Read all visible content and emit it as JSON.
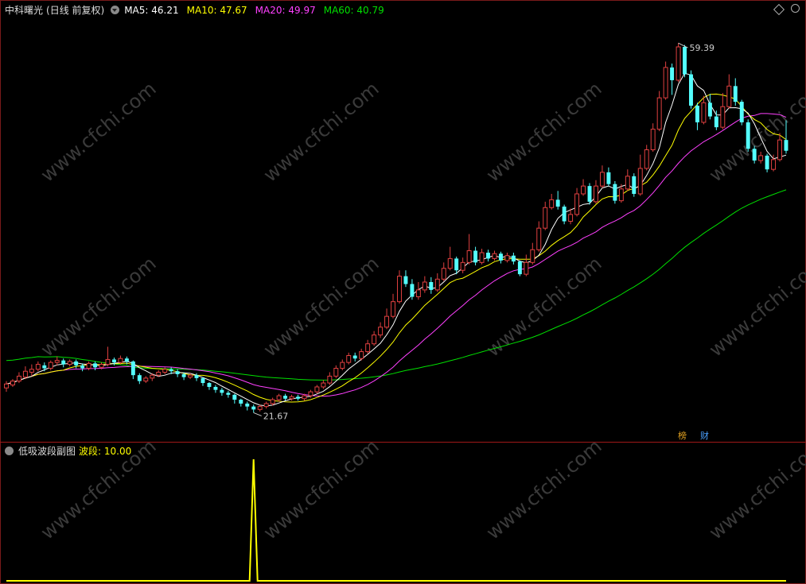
{
  "main_header": {
    "stock_name": "中科曙光",
    "period": "(日线 前复权)",
    "ma_items": [
      {
        "label": "MA5: 46.21",
        "color": "#ffffff"
      },
      {
        "label": "MA10: 47.67",
        "color": "#ffff00"
      },
      {
        "label": "MA20: 49.97",
        "color": "#ff40ff"
      },
      {
        "label": "MA60: 40.79",
        "color": "#00e000"
      }
    ]
  },
  "sub_header": {
    "indicator_name": "低吸波段副图",
    "value_label": "波段: 10.00",
    "value_color": "#ffff00"
  },
  "badges": {
    "left": "榜",
    "right": "财"
  },
  "watermark": "www.cfchi.com",
  "colors": {
    "up": "#e04040",
    "down": "#54ffff",
    "ma5": "#ffffff",
    "ma10": "#ffff00",
    "ma20": "#ff40ff",
    "ma60": "#00e000",
    "border": "#a01818"
  },
  "chart_data": [
    {
      "type": "candlestick",
      "title": "中科曙光 (日线 前复权)",
      "high_label": "59.39",
      "low_label": "21.67",
      "ylim": [
        20,
        62
      ],
      "candles": [
        [
          24.2,
          24.6,
          23.8,
          24.9
        ],
        [
          24.5,
          24.9,
          24.3,
          25.1
        ],
        [
          24.9,
          25.4,
          24.7,
          25.8
        ],
        [
          25.3,
          25.9,
          25.1,
          26.4
        ],
        [
          25.8,
          26.1,
          25.4,
          26.6
        ],
        [
          26.1,
          26.6,
          25.9,
          26.9
        ],
        [
          26.5,
          26.2,
          25.9,
          26.8
        ],
        [
          26.2,
          26.8,
          26.0,
          27.0
        ],
        [
          26.8,
          27.0,
          26.5,
          27.4
        ],
        [
          27.0,
          26.6,
          26.3,
          27.2
        ],
        [
          26.6,
          26.9,
          26.4,
          27.1
        ],
        [
          26.9,
          26.5,
          26.2,
          27.1
        ],
        [
          26.5,
          26.2,
          25.9,
          26.7
        ],
        [
          26.2,
          26.7,
          26.0,
          26.9
        ],
        [
          26.7,
          26.3,
          26.0,
          26.9
        ],
        [
          26.3,
          26.6,
          26.1,
          26.8
        ],
        [
          26.6,
          27.1,
          26.4,
          28.4
        ],
        [
          27.1,
          26.8,
          26.5,
          27.3
        ],
        [
          26.8,
          27.2,
          26.6,
          27.5
        ],
        [
          27.2,
          26.9,
          26.6,
          27.4
        ],
        [
          26.9,
          25.5,
          25.1,
          27.0
        ],
        [
          25.5,
          24.9,
          24.6,
          25.7
        ],
        [
          24.9,
          25.2,
          24.7,
          25.4
        ],
        [
          25.2,
          25.5,
          24.9,
          25.7
        ],
        [
          25.5,
          25.8,
          25.3,
          26.0
        ],
        [
          25.8,
          26.1,
          25.6,
          26.3
        ],
        [
          26.1,
          25.9,
          25.6,
          26.3
        ],
        [
          25.9,
          25.6,
          25.3,
          26.1
        ],
        [
          25.6,
          25.3,
          25.0,
          25.8
        ],
        [
          25.3,
          25.5,
          25.1,
          25.7
        ],
        [
          25.5,
          25.2,
          24.9,
          25.7
        ],
        [
          25.2,
          24.7,
          24.4,
          25.3
        ],
        [
          24.7,
          24.3,
          24.0,
          24.8
        ],
        [
          24.3,
          24.0,
          23.7,
          24.5
        ],
        [
          24.0,
          23.7,
          23.4,
          24.2
        ],
        [
          23.7,
          23.5,
          23.2,
          23.9
        ],
        [
          23.5,
          23.0,
          22.6,
          23.6
        ],
        [
          23.0,
          22.6,
          22.3,
          23.1
        ],
        [
          22.6,
          22.3,
          21.9,
          22.8
        ],
        [
          22.3,
          22.0,
          21.67,
          22.5
        ],
        [
          22.0,
          22.3,
          21.8,
          22.5
        ],
        [
          22.3,
          22.6,
          22.1,
          22.8
        ],
        [
          22.6,
          23.0,
          22.4,
          23.2
        ],
        [
          23.0,
          23.4,
          22.8,
          23.6
        ],
        [
          23.4,
          23.1,
          22.9,
          23.6
        ],
        [
          23.1,
          23.3,
          22.9,
          23.5
        ],
        [
          23.3,
          23.1,
          22.9,
          23.5
        ],
        [
          23.1,
          23.4,
          22.9,
          23.6
        ],
        [
          23.4,
          23.8,
          23.2,
          24.0
        ],
        [
          23.8,
          24.3,
          23.6,
          24.5
        ],
        [
          24.3,
          24.7,
          24.1,
          25.0
        ],
        [
          24.7,
          25.4,
          24.5,
          25.8
        ],
        [
          25.4,
          26.2,
          25.2,
          26.5
        ],
        [
          26.2,
          26.8,
          26.0,
          27.1
        ],
        [
          26.8,
          27.5,
          26.6,
          27.8
        ],
        [
          27.5,
          27.2,
          26.9,
          27.8
        ],
        [
          27.2,
          27.9,
          27.0,
          28.2
        ],
        [
          27.9,
          28.7,
          27.7,
          29.1
        ],
        [
          28.7,
          29.6,
          28.5,
          30.0
        ],
        [
          29.6,
          30.4,
          29.3,
          30.9
        ],
        [
          30.4,
          31.5,
          30.2,
          32.3
        ],
        [
          31.5,
          33.0,
          31.3,
          33.8
        ],
        [
          33.0,
          35.6,
          32.8,
          36.2
        ],
        [
          35.6,
          34.8,
          34.5,
          36.2
        ],
        [
          34.8,
          33.5,
          33.2,
          35.3
        ],
        [
          33.5,
          34.2,
          33.2,
          35.0
        ],
        [
          34.2,
          35.0,
          33.9,
          35.6
        ],
        [
          35.0,
          34.2,
          33.8,
          35.5
        ],
        [
          34.2,
          35.3,
          34.0,
          35.9
        ],
        [
          35.3,
          36.4,
          35.1,
          37.0
        ],
        [
          36.4,
          37.4,
          36.2,
          38.6
        ],
        [
          37.4,
          36.2,
          35.8,
          37.6
        ],
        [
          36.2,
          37.0,
          35.9,
          37.5
        ],
        [
          37.0,
          38.2,
          36.8,
          39.9
        ],
        [
          38.2,
          37.0,
          36.7,
          38.6
        ],
        [
          37.0,
          38.0,
          36.8,
          38.4
        ],
        [
          38.0,
          37.4,
          37.1,
          38.3
        ],
        [
          37.4,
          37.9,
          37.2,
          38.2
        ],
        [
          37.9,
          37.2,
          36.9,
          38.1
        ],
        [
          37.2,
          37.7,
          37.0,
          38.0
        ],
        [
          37.7,
          37.1,
          36.8,
          38.0
        ],
        [
          37.1,
          35.8,
          35.6,
          37.2
        ],
        [
          35.8,
          37.0,
          35.6,
          37.8
        ],
        [
          37.0,
          38.3,
          36.8,
          39.0
        ],
        [
          38.3,
          40.5,
          38.1,
          41.2
        ],
        [
          40.5,
          42.6,
          40.3,
          43.2
        ],
        [
          42.6,
          43.4,
          42.4,
          44.0
        ],
        [
          43.4,
          42.7,
          42.4,
          44.3
        ],
        [
          42.7,
          41.2,
          40.9,
          42.9
        ],
        [
          41.2,
          41.9,
          40.9,
          42.5
        ],
        [
          41.9,
          44.0,
          41.7,
          44.6
        ],
        [
          44.0,
          44.8,
          43.8,
          45.5
        ],
        [
          44.8,
          43.2,
          42.9,
          45.1
        ],
        [
          43.2,
          44.8,
          43.0,
          45.4
        ],
        [
          44.8,
          46.2,
          44.6,
          46.9
        ],
        [
          46.2,
          45.0,
          44.8,
          46.7
        ],
        [
          45.0,
          43.3,
          43.0,
          45.3
        ],
        [
          43.3,
          44.5,
          43.1,
          45.0
        ],
        [
          44.5,
          45.8,
          44.3,
          46.5
        ],
        [
          45.8,
          44.0,
          43.7,
          46.1
        ],
        [
          44.0,
          46.6,
          43.8,
          48.0
        ],
        [
          46.6,
          48.5,
          46.4,
          49.0
        ],
        [
          48.5,
          50.6,
          48.3,
          51.2
        ],
        [
          50.6,
          53.8,
          50.4,
          54.5
        ],
        [
          53.8,
          56.9,
          53.6,
          57.5
        ],
        [
          56.9,
          55.6,
          54.1,
          57.3
        ],
        [
          55.6,
          59.0,
          55.4,
          59.39
        ],
        [
          59.0,
          56.2,
          55.9,
          59.2
        ],
        [
          56.2,
          53.0,
          52.7,
          56.6
        ],
        [
          53.0,
          51.3,
          50.5,
          53.3
        ],
        [
          51.3,
          53.3,
          51.1,
          54.0
        ],
        [
          53.3,
          51.9,
          51.6,
          54.2
        ],
        [
          51.9,
          50.8,
          50.5,
          52.5
        ],
        [
          50.8,
          52.9,
          50.6,
          54.3
        ],
        [
          52.9,
          55.0,
          52.7,
          56.2
        ],
        [
          55.0,
          53.4,
          53.0,
          55.8
        ],
        [
          53.4,
          51.3,
          51.0,
          53.6
        ],
        [
          51.3,
          48.6,
          48.3,
          51.6
        ],
        [
          48.6,
          47.4,
          47.1,
          48.9
        ],
        [
          47.4,
          47.9,
          47.1,
          48.3
        ],
        [
          47.9,
          46.5,
          46.2,
          48.1
        ],
        [
          46.5,
          47.5,
          46.3,
          48.0
        ],
        [
          47.5,
          49.5,
          47.3,
          50.2
        ],
        [
          49.5,
          48.4,
          48.1,
          51.5
        ]
      ]
    },
    {
      "type": "line",
      "title": "低吸波段副图",
      "series": [
        {
          "name": "波段",
          "last_value": 10.0
        }
      ],
      "ylim": [
        0,
        100
      ],
      "baseline": 0,
      "spikes": [
        {
          "index": 39,
          "value": 100
        }
      ]
    }
  ]
}
